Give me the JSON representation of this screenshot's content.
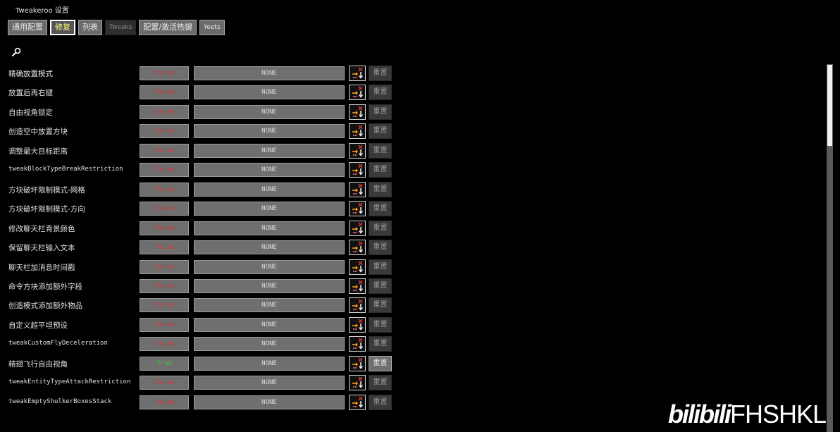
{
  "window": {
    "title": "Tweakeroo 设置"
  },
  "tabs": [
    {
      "label": "通用配置",
      "state": "normal"
    },
    {
      "label": "修复",
      "state": "active"
    },
    {
      "label": "列表",
      "state": "normal"
    },
    {
      "label": "Tweaks",
      "state": "disabled"
    },
    {
      "label": "配置/激活热键",
      "state": "normal"
    },
    {
      "label": "Yeets",
      "state": "normal"
    }
  ],
  "search": {
    "icon": "magnifier-icon"
  },
  "reset_label": "重置",
  "rows": [
    {
      "label": "精确放置模式",
      "value": "false",
      "hotkey": "NONE",
      "reset_enabled": false
    },
    {
      "label": "放置后再右键",
      "value": "false",
      "hotkey": "NONE",
      "reset_enabled": false
    },
    {
      "label": "自由视角锁定",
      "value": "false",
      "hotkey": "NONE",
      "reset_enabled": false
    },
    {
      "label": "创造空中放置方块",
      "value": "false",
      "hotkey": "NONE",
      "reset_enabled": false
    },
    {
      "label": "调整最大目标距离",
      "value": "false",
      "hotkey": "NONE",
      "reset_enabled": false
    },
    {
      "label": "tweakBlockTypeBreakRestriction",
      "value": "false",
      "hotkey": "NONE",
      "reset_enabled": false
    },
    {
      "label": "方块破坏限制模式-网格",
      "value": "false",
      "hotkey": "NONE",
      "reset_enabled": false
    },
    {
      "label": "方块破坏限制模式-方向",
      "value": "false",
      "hotkey": "NONE",
      "reset_enabled": false
    },
    {
      "label": "修改聊天栏背景颜色",
      "value": "false",
      "hotkey": "NONE",
      "reset_enabled": false
    },
    {
      "label": "保留聊天栏输入文本",
      "value": "false",
      "hotkey": "NONE",
      "reset_enabled": false
    },
    {
      "label": "聊天栏加消息时间戳",
      "value": "false",
      "hotkey": "NONE",
      "reset_enabled": false
    },
    {
      "label": "命令方块添加额外字段",
      "value": "false",
      "hotkey": "NONE",
      "reset_enabled": false
    },
    {
      "label": "创造模式添加额外物品",
      "value": "false",
      "hotkey": "NONE",
      "reset_enabled": false
    },
    {
      "label": "自定义超平坦预设",
      "value": "false",
      "hotkey": "NONE",
      "reset_enabled": false
    },
    {
      "label": "tweakCustomFlyDeceleration",
      "value": "false",
      "hotkey": "NONE",
      "reset_enabled": false
    },
    {
      "label": "精翅飞行自由视角",
      "value": "true",
      "hotkey": "NONE",
      "reset_enabled": true
    },
    {
      "label": "tweakEntityTypeAttackRestriction",
      "value": "false",
      "hotkey": "NONE",
      "reset_enabled": false
    },
    {
      "label": "tweakEmptyShulkerBoxesStack",
      "value": "false",
      "hotkey": "NONE",
      "reset_enabled": false
    }
  ],
  "watermark": {
    "brand": "bilibili",
    "user": "FHSHKL"
  },
  "colors": {
    "false": "#e03030",
    "true": "#30d030",
    "background": "#000000"
  }
}
